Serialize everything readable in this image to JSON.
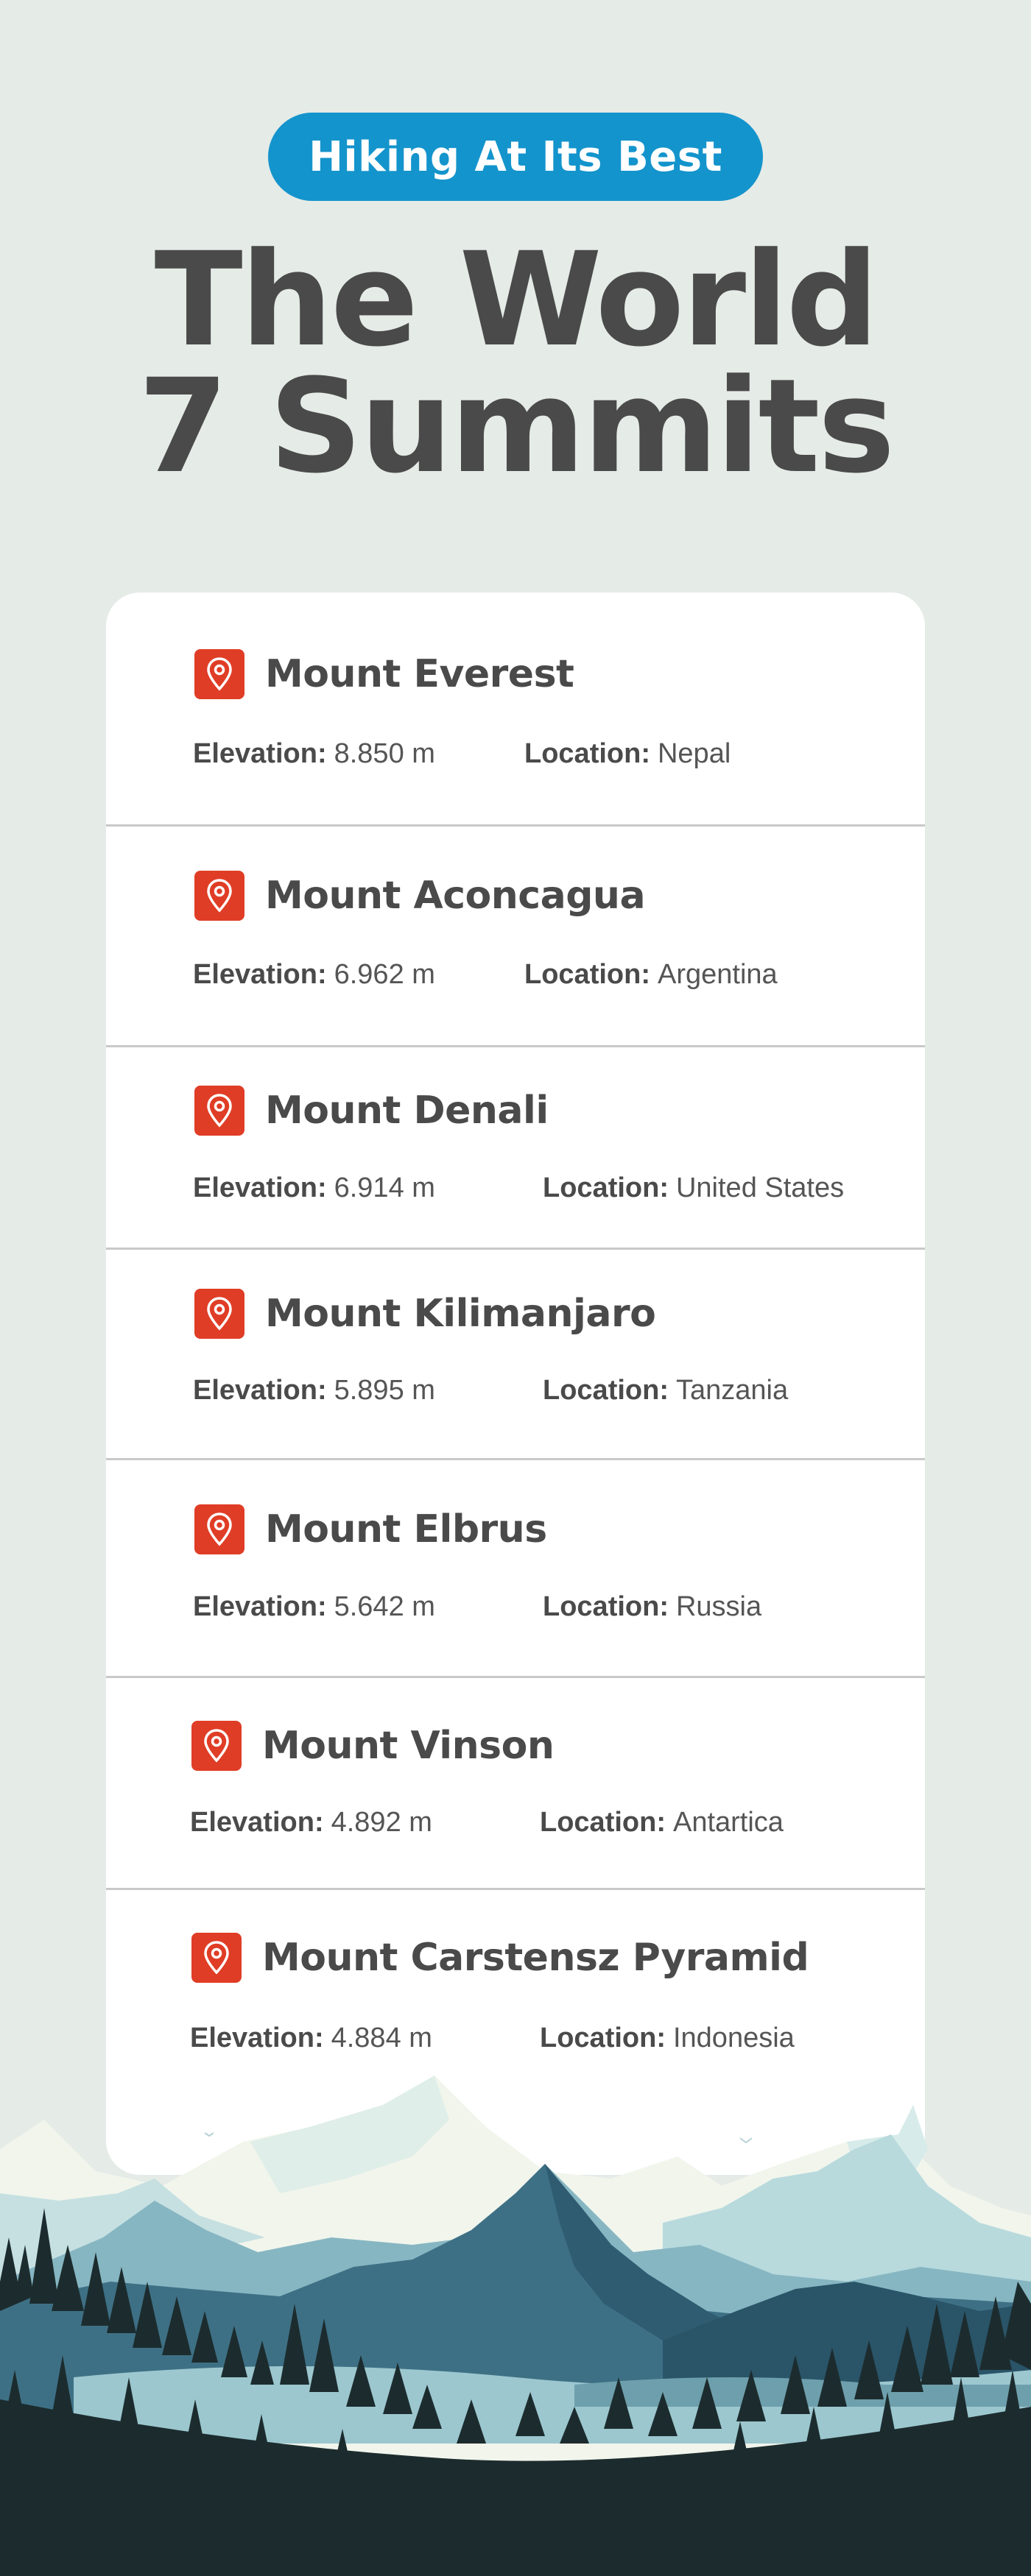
{
  "header": {
    "badge": "Hiking At Its Best",
    "title_line1": "The World",
    "title_line2": "7 Summits"
  },
  "labels": {
    "elevation": "Elevation:",
    "location": "Location:"
  },
  "summits": [
    {
      "name": "Mount Everest",
      "elevation": "8.850 m",
      "location": "Nepal"
    },
    {
      "name": "Mount Aconcagua",
      "elevation": "6.962 m",
      "location": "Argentina"
    },
    {
      "name": "Mount Denali",
      "elevation": "6.914 m",
      "location": "United States"
    },
    {
      "name": "Mount Kilimanjaro",
      "elevation": "5.895 m",
      "location": "Tanzania"
    },
    {
      "name": "Mount Elbrus",
      "elevation": "5.642 m",
      "location": "Russia"
    },
    {
      "name": "Mount Vinson",
      "elevation": "4.892 m",
      "location": "Antartica"
    },
    {
      "name": "Mount Carstensz Pyramid",
      "elevation": "4.884 m",
      "location": "Indonesia"
    }
  ],
  "icons": {
    "summit_marker": "location-pin-icon"
  },
  "colors": {
    "background": "#e5ebe7",
    "badge": "#1494cc",
    "title": "#4a4a4a",
    "pin": "#e03d26",
    "card": "#ffffff"
  }
}
